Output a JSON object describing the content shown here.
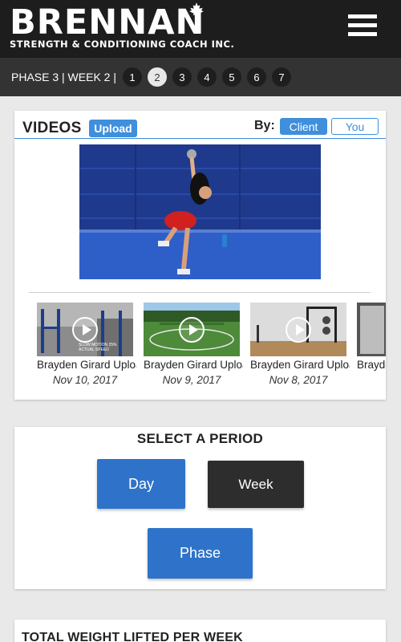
{
  "brand": {
    "name": "BRENNAN",
    "tagline": "STRENGTH & CONDITIONING COACH INC."
  },
  "phase_bar": {
    "label": "PHASE 3 | WEEK 2 |",
    "weeks": [
      "1",
      "2",
      "3",
      "4",
      "5",
      "6",
      "7"
    ],
    "active_week": "2"
  },
  "videos": {
    "title": "VIDEOS",
    "upload_label": "Upload",
    "by_label": "By:",
    "filter_client": "Client",
    "filter_you": "You",
    "thumbnails": [
      {
        "title": "Brayden Girard Upload",
        "date": "Nov 10, 2017",
        "overlay": "SLOW MOTION 25% ACTUAL SPEED"
      },
      {
        "title": "Brayden Girard Upload",
        "date": "Nov 9, 2017"
      },
      {
        "title": "Brayden Girard Upload",
        "date": "Nov 8, 2017"
      },
      {
        "title": "Brayden Girard Upload",
        "date": ""
      }
    ]
  },
  "period": {
    "title": "SELECT A PERIOD",
    "day_label": "Day",
    "week_label": "Week",
    "phase_label": "Phase"
  },
  "total": {
    "title": "TOTAL WEIGHT LIFTED PER WEEK"
  },
  "colors": {
    "header_bg": "#1d1d1d",
    "phase_bar_bg": "#333333",
    "accent_blue": "#3f8fdc",
    "button_blue": "#2e73c9",
    "button_dark": "#2d2d2d"
  },
  "icons": {
    "menu": "hamburger-menu-icon",
    "play": "play-icon",
    "brand_leaf": "maple-leaf-icon"
  }
}
